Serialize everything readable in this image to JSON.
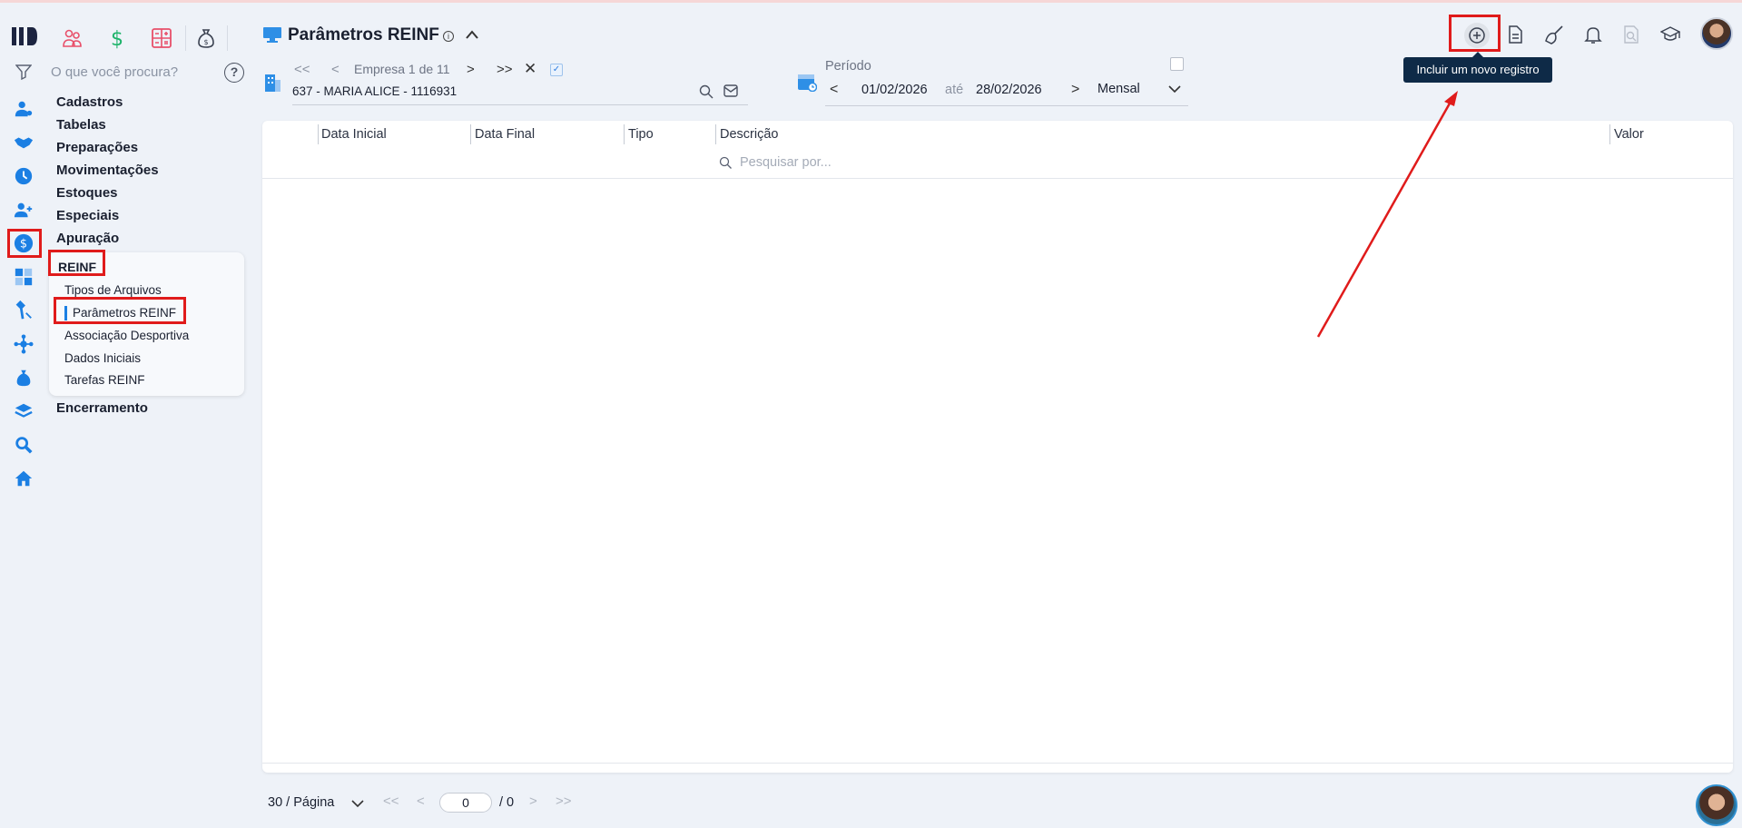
{
  "header": {
    "title": "Parâmetros REINF",
    "info_glyph": "i"
  },
  "modules": [
    "people-group-icon",
    "dollar-icon",
    "calculator-icon",
    "money-bag-icon"
  ],
  "search": {
    "placeholder": "O que você procura?",
    "help_glyph": "?"
  },
  "menu": {
    "items": [
      "Cadastros",
      "Tabelas",
      "Preparações",
      "Movimentações",
      "Estoques",
      "Especiais",
      "Apuração"
    ],
    "submenu_title": "REINF",
    "submenu_items": [
      "Tipos de Arquivos",
      "Parâmetros REINF",
      "Associação Desportiva",
      "Dados Iniciais",
      "Tarefas REINF"
    ],
    "after_item": "Encerramento"
  },
  "empresa": {
    "first": "<<",
    "prev": "<",
    "label": "Empresa 1 de 11",
    "next": ">",
    "last": ">>",
    "clear": "✕",
    "check": "✓",
    "value": "637 - MARIA ALICE - 1116931"
  },
  "periodo": {
    "label": "Período",
    "prev": "<",
    "start": "01/02/2026",
    "sep": "até",
    "end": "28/02/2026",
    "next": ">",
    "mode": "Mensal"
  },
  "toolbar": {
    "tooltip": "Incluir um novo registro",
    "icons": [
      "add-circle-icon",
      "document-icon",
      "broom-icon",
      "bell-icon",
      "report-search-icon",
      "graduation-cap-icon"
    ]
  },
  "grid": {
    "columns": [
      "Data Inicial",
      "Data Final",
      "Tipo",
      "Descrição",
      "Valor"
    ],
    "search_placeholder": "Pesquisar por..."
  },
  "pagination": {
    "page_size": "30 / Página",
    "first": "<<",
    "prev": "<",
    "current": "0",
    "total": "/ 0",
    "next": ">",
    "last": ">>"
  },
  "colors": {
    "accent": "#1b7fe3",
    "highlight": "#e01b1b",
    "tooltip_bg": "#0e2a47",
    "background": "#eef2f8"
  }
}
